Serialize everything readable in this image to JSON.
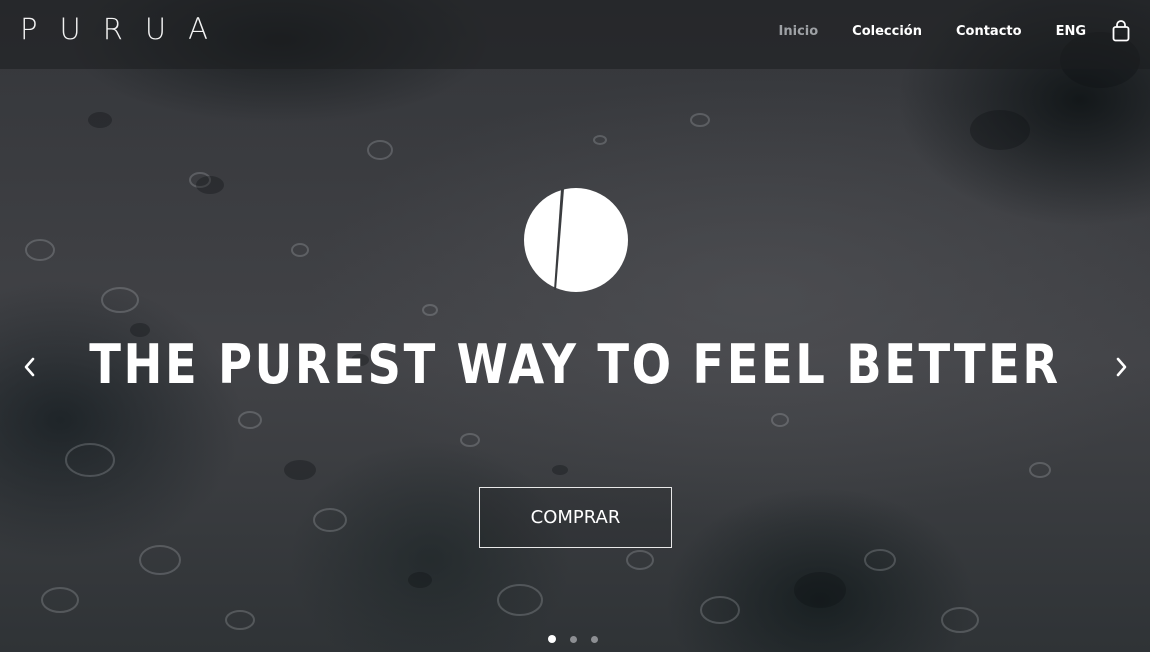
{
  "brand": {
    "logo_text": "PURUA"
  },
  "nav": {
    "items": [
      {
        "label": "Inicio",
        "active": true
      },
      {
        "label": "Colección",
        "active": false
      },
      {
        "label": "Contacto",
        "active": false
      },
      {
        "label": "ENG",
        "active": false
      }
    ],
    "cart_icon": "shopping-bag-icon"
  },
  "hero": {
    "emblem_icon": "purua-emblem-icon",
    "headline": "THE PUREST WAY TO FEEL BETTER",
    "cta_label": "COMPRAR",
    "prev_icon": "chevron-left-icon",
    "next_icon": "chevron-right-icon",
    "slides_total": 3,
    "active_slide": 1
  },
  "colors": {
    "text": "#ffffff",
    "nav_active": "#9ea1a5",
    "topbar": "#1c1d1f",
    "background": "#3a3c3f"
  }
}
